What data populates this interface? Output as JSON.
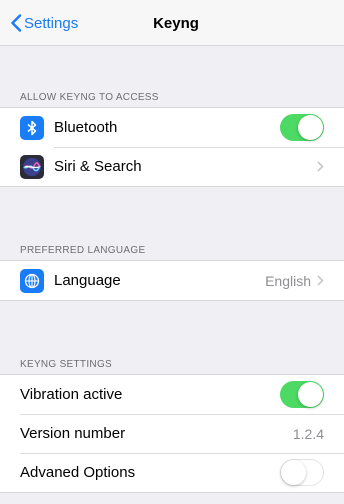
{
  "nav": {
    "back_label": "Settings",
    "title": "Keyng"
  },
  "sections": {
    "access": {
      "header": "ALLOW KEYNG TO ACCESS",
      "bluetooth": {
        "label": "Bluetooth",
        "enabled": true,
        "icon": "bluetooth-icon"
      },
      "siri": {
        "label": "Siri & Search",
        "icon": "siri-icon"
      }
    },
    "language": {
      "header": "PREFERRED LANGUAGE",
      "language": {
        "label": "Language",
        "value": "English",
        "icon": "globe-icon"
      }
    },
    "settings": {
      "header": "KEYNG SETTINGS",
      "vibration": {
        "label": "Vibration active",
        "enabled": true
      },
      "version": {
        "label": "Version number",
        "value": "1.2.4"
      },
      "advanced": {
        "label": "Advaned Options",
        "enabled": false
      }
    }
  },
  "colors": {
    "accent": "#1a7cf6",
    "toggle_on": "#4cd964",
    "background": "#efeff4"
  }
}
